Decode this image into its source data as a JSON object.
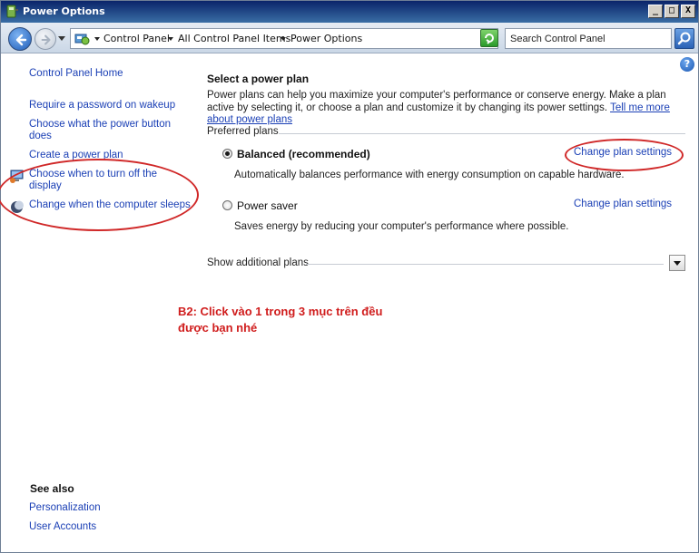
{
  "window": {
    "title": "Power Options",
    "controls": {
      "minimize": "_",
      "maximize": "□",
      "close": "X"
    }
  },
  "address_bar": {
    "breadcrumbs": [
      "Control Panel",
      "All Control Panel Items",
      "Power Options"
    ],
    "search_placeholder": "Search Control Panel"
  },
  "sidebar": {
    "home": "Control Panel Home",
    "tasks": [
      {
        "label": "Require a password on wakeup",
        "icon": "none"
      },
      {
        "label": "Choose what the power button does",
        "icon": "none"
      },
      {
        "label": "Create a power plan",
        "icon": "none"
      },
      {
        "label": "Choose when to turn off the display",
        "icon": "monitor-icon"
      },
      {
        "label": "Change when the computer sleeps",
        "icon": "moon-icon"
      }
    ],
    "see_also_title": "See also",
    "see_also": [
      "Personalization",
      "User Accounts"
    ]
  },
  "main": {
    "help": "?",
    "title": "Select a power plan",
    "description": "Power plans can help you maximize your computer's performance or conserve energy. Make a plan active by selecting it, or choose a plan and customize it by changing its power settings. ",
    "tell_me_more": "Tell me more about power plans",
    "preferred_label": "Preferred plans",
    "plans": [
      {
        "name": "Balanced (recommended)",
        "selected": true,
        "description": "Automatically balances performance with energy consumption on capable hardware.",
        "link": "Change plan settings"
      },
      {
        "name": "Power saver",
        "selected": false,
        "description": "Saves energy by reducing your computer's performance where possible.",
        "link": "Change plan settings"
      }
    ],
    "show_additional": "Show additional plans"
  },
  "annotation": {
    "text_line1": "B2: Click vào 1 trong 3 mục trên đều",
    "text_line2": "được bạn nhé",
    "color": "#d01d1d"
  }
}
